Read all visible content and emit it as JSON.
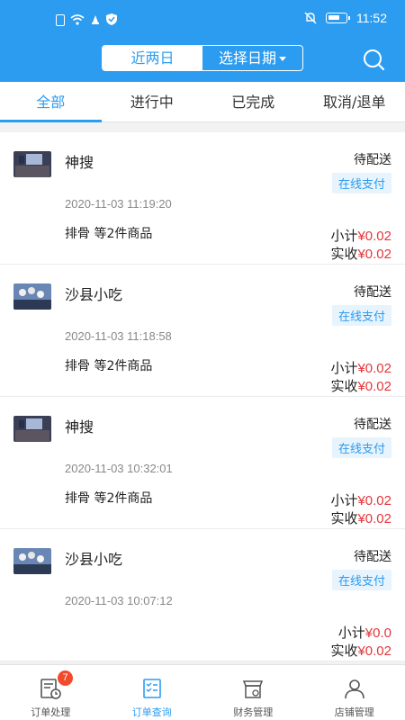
{
  "status_bar": {
    "time": "11:52"
  },
  "header": {
    "range_tabs": [
      {
        "label": "近两日",
        "selected": true
      },
      {
        "label": "选择日期",
        "selected": false
      }
    ],
    "search_icon": "search-icon",
    "color": "#2c9cf0"
  },
  "tabs": [
    {
      "label": "全部",
      "active": true
    },
    {
      "label": "进行中",
      "active": false
    },
    {
      "label": "已完成",
      "active": false
    },
    {
      "label": "取消/退单",
      "active": false
    }
  ],
  "orders": [
    {
      "shop": "神搜",
      "status": "待配送",
      "payment": "在线支付",
      "time": "2020-11-03 11:19:20",
      "goods": "排骨 等2件商品",
      "subtotal_label": "小计",
      "subtotal": "¥0.02",
      "paid_label": "实收",
      "paid": "¥0.02"
    },
    {
      "shop": "沙县小吃",
      "status": "待配送",
      "payment": "在线支付",
      "time": "2020-11-03 11:18:58",
      "goods": "排骨 等2件商品",
      "subtotal_label": "小计",
      "subtotal": "¥0.02",
      "paid_label": "实收",
      "paid": "¥0.02"
    },
    {
      "shop": "神搜",
      "status": "待配送",
      "payment": "在线支付",
      "time": "2020-11-03 10:32:01",
      "goods": "排骨 等2件商品",
      "subtotal_label": "小计",
      "subtotal": "¥0.02",
      "paid_label": "实收",
      "paid": "¥0.02"
    },
    {
      "shop": "沙县小吃",
      "status": "待配送",
      "payment": "在线支付",
      "time": "2020-11-03 10:07:12",
      "goods": "",
      "subtotal_label": "小计",
      "subtotal": "¥0.0",
      "paid_label": "实收",
      "paid": "¥0.02"
    }
  ],
  "bottom_nav": [
    {
      "label": "订单处理",
      "icon": "order-process-icon",
      "badge": "7",
      "active": false
    },
    {
      "label": "订单查询",
      "icon": "order-query-icon",
      "active": true
    },
    {
      "label": "财务管理",
      "icon": "finance-icon",
      "active": false
    },
    {
      "label": "店铺管理",
      "icon": "store-manage-icon",
      "active": false
    }
  ],
  "colors": {
    "accent": "#2c9cf0",
    "price": "#e3363b",
    "badge": "#f24a2a"
  }
}
